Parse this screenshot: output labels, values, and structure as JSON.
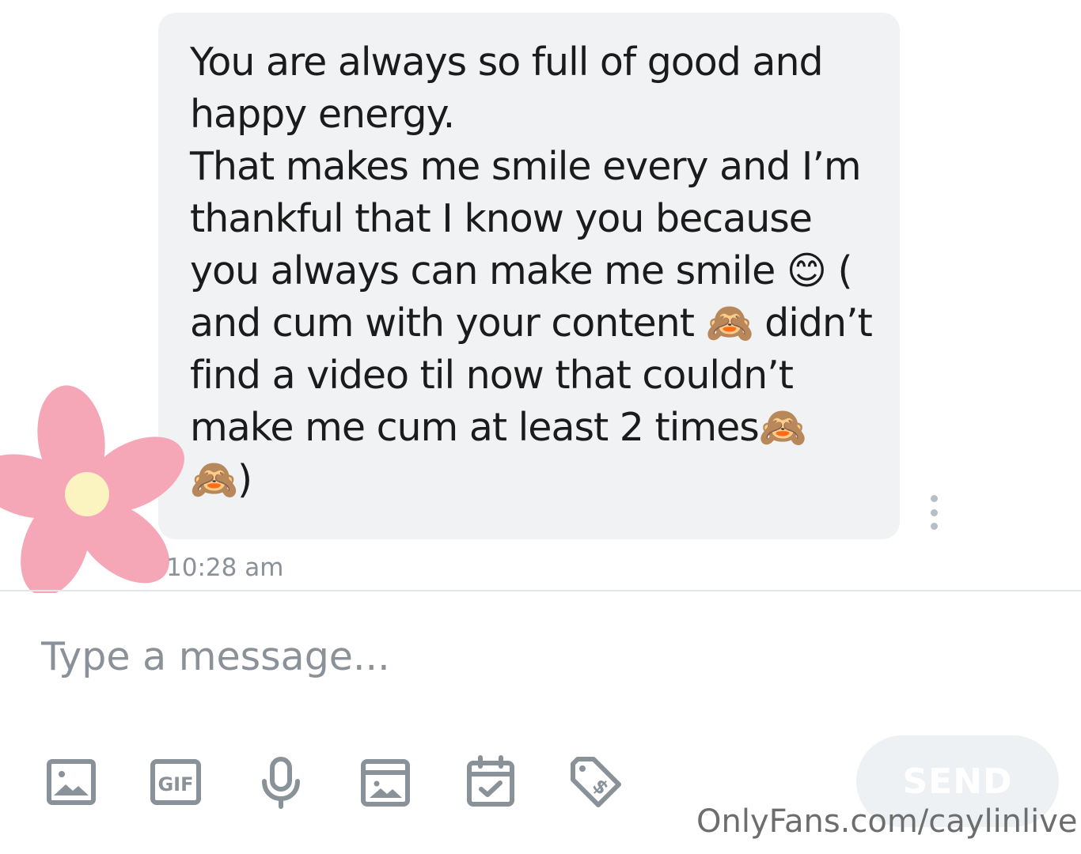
{
  "message": {
    "text": "You are always so full of good and\nhappy energy.\nThat makes me smile every and I’m\nthankful that I know you because\nyou always can make me smile 😊 (\nand cum with your content 🙈 didn’t\nfind a video til now that couldn’t\nmake me cum at least 2 times🙈\n🙈)",
    "time": "10:28 am"
  },
  "composer": {
    "placeholder": "Type a message...",
    "send_label": "SEND"
  },
  "toolbar": {
    "icons": [
      "image-icon",
      "gif-icon",
      "microphone-icon",
      "media-vault-icon",
      "calendar-icon",
      "price-tag-icon"
    ],
    "gif_text": "GIF"
  },
  "colors": {
    "bubble": "#f0f2f4",
    "icon": "#8a9299",
    "send_button_bg": "#eef1f3",
    "flower_petal": "#f5a7b8",
    "flower_center": "#fbf3c0"
  },
  "watermark": "OnlyFans.com/caylinlive"
}
